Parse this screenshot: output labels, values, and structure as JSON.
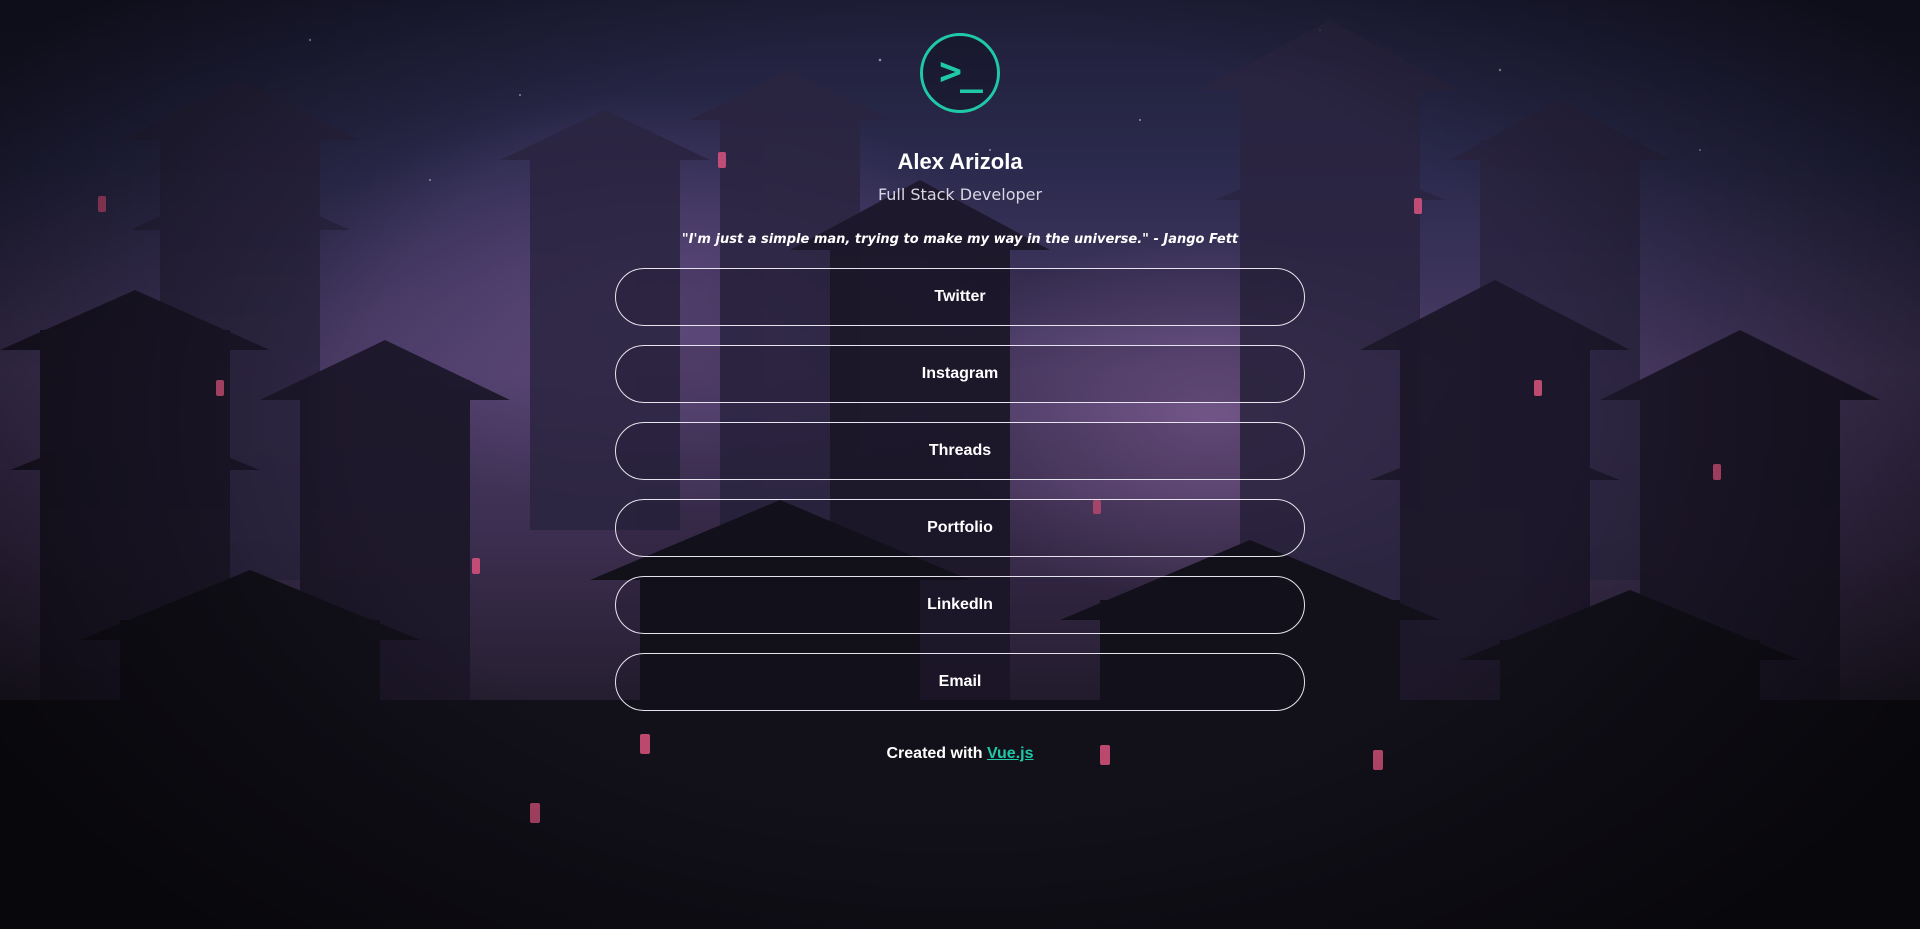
{
  "profile": {
    "avatar_glyph": ">_",
    "avatar_icon": "terminal-prompt-icon",
    "name": "Alex Arizola",
    "role": "Full Stack Developer",
    "quote": "\"I'm just a simple man, trying to make my way in the universe.\" - Jango Fett"
  },
  "links": [
    {
      "label": "Twitter"
    },
    {
      "label": "Instagram"
    },
    {
      "label": "Threads"
    },
    {
      "label": "Portfolio"
    },
    {
      "label": "LinkedIn"
    },
    {
      "label": "Email"
    }
  ],
  "footer": {
    "prefix": "Created with ",
    "link_label": "Vue.js"
  },
  "colors": {
    "accent": "#1fc9a8",
    "text": "#ffffff",
    "button_border": "#e6e3ee"
  }
}
